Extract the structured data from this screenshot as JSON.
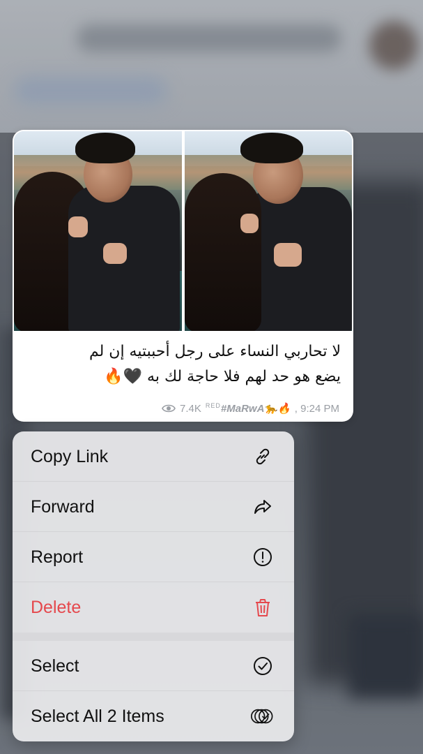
{
  "message": {
    "text_line1": "لا تحاربي النساء على رجل أحببتيه إن لم",
    "text_line2": "يضع هو حد لهم فلا حاجة لك به 🖤🔥",
    "views": "7.4K",
    "signature_prefix": "RED",
    "signature": "#MaRwA🐆🔥",
    "time": ", 9:24 PM"
  },
  "menu": {
    "items": [
      {
        "label": "Copy Link",
        "icon": "link-icon"
      },
      {
        "label": "Forward",
        "icon": "forward-icon"
      },
      {
        "label": "Report",
        "icon": "report-icon"
      },
      {
        "label": "Delete",
        "icon": "trash-icon",
        "color": "#e5484d"
      },
      {
        "label": "Select",
        "icon": "check-circle-icon"
      },
      {
        "label": "Select All 2 Items",
        "icon": "multi-check-icon"
      }
    ]
  },
  "colors": {
    "danger": "#e5484d",
    "meta_gray": "#9a9ea4"
  }
}
